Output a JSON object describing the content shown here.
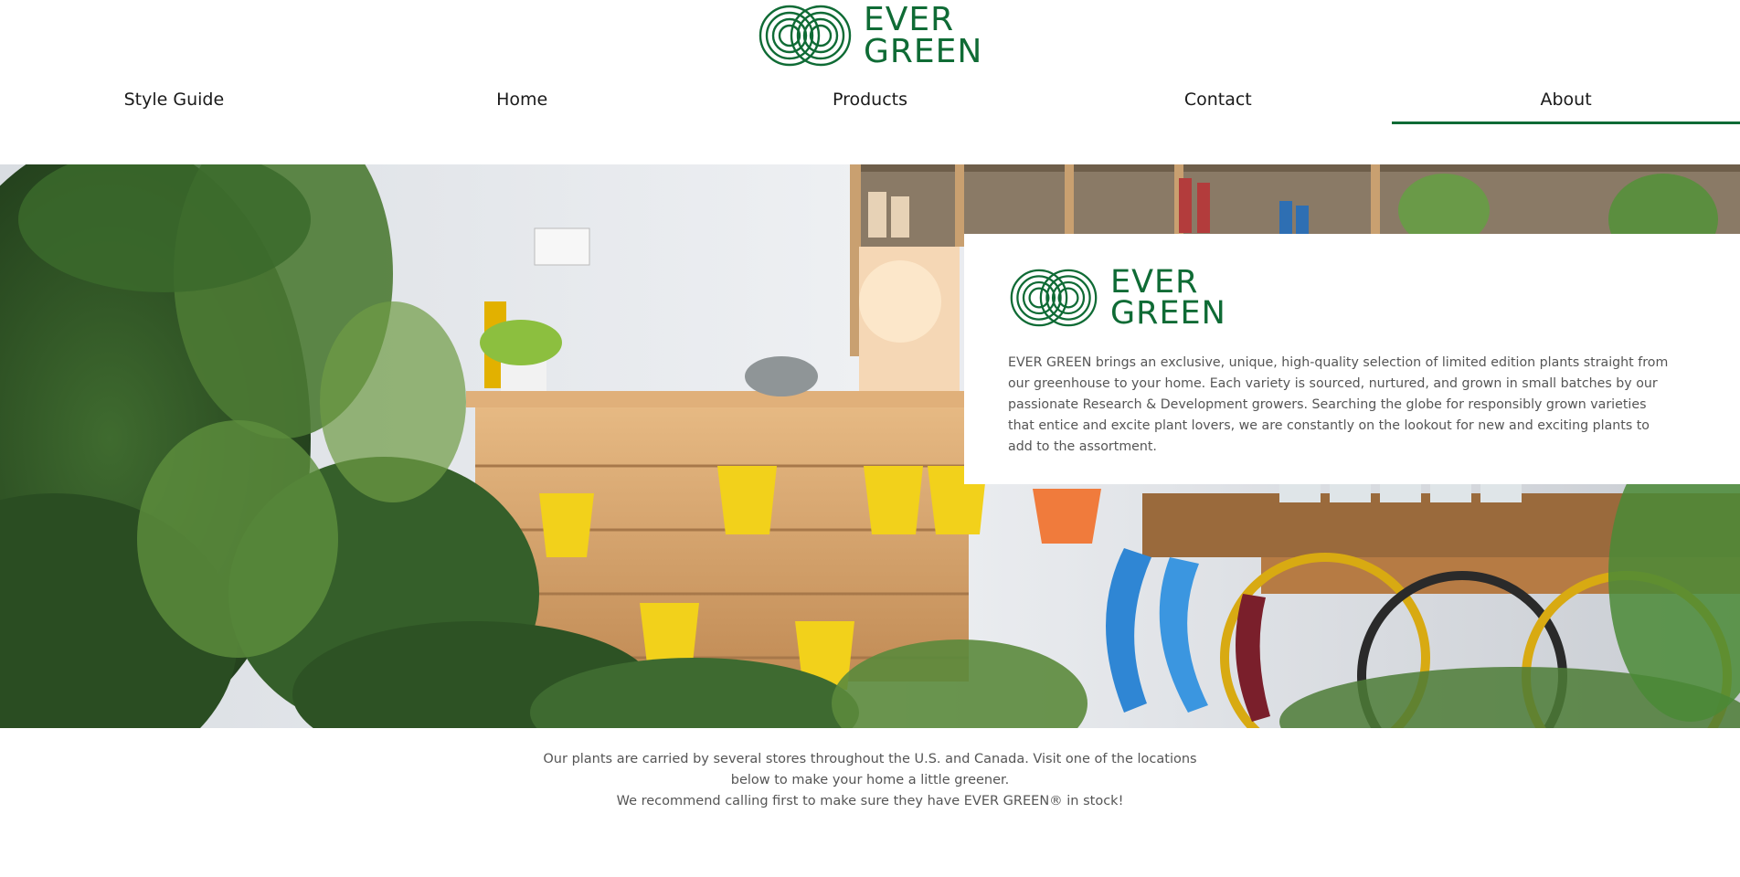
{
  "brand": {
    "line1": "EVER",
    "line2": "GREEN",
    "color": "#0f6b35"
  },
  "nav": {
    "items": [
      {
        "label": "Style Guide"
      },
      {
        "label": "Home"
      },
      {
        "label": "Products"
      },
      {
        "label": "Contact"
      },
      {
        "label": "About",
        "active": true
      }
    ]
  },
  "about": {
    "paragraph": "EVER GREEN brings an exclusive, unique, high-quality selection of limited edition plants straight from our greenhouse to your home. Each variety is sourced, nurtured, and grown in small batches by our passionate Research & Development growers. Searching the globe for responsibly grown varieties that entice and excite plant lovers, we are constantly on the lookout for new and exciting plants to add to the assortment."
  },
  "footer": {
    "line1": "Our plants are carried by several stores throughout the U.S. and Canada. Visit one of the locations below to make your home a little greener.",
    "line2": "We recommend calling first to make sure they have EVER GREEN® in stock!"
  }
}
